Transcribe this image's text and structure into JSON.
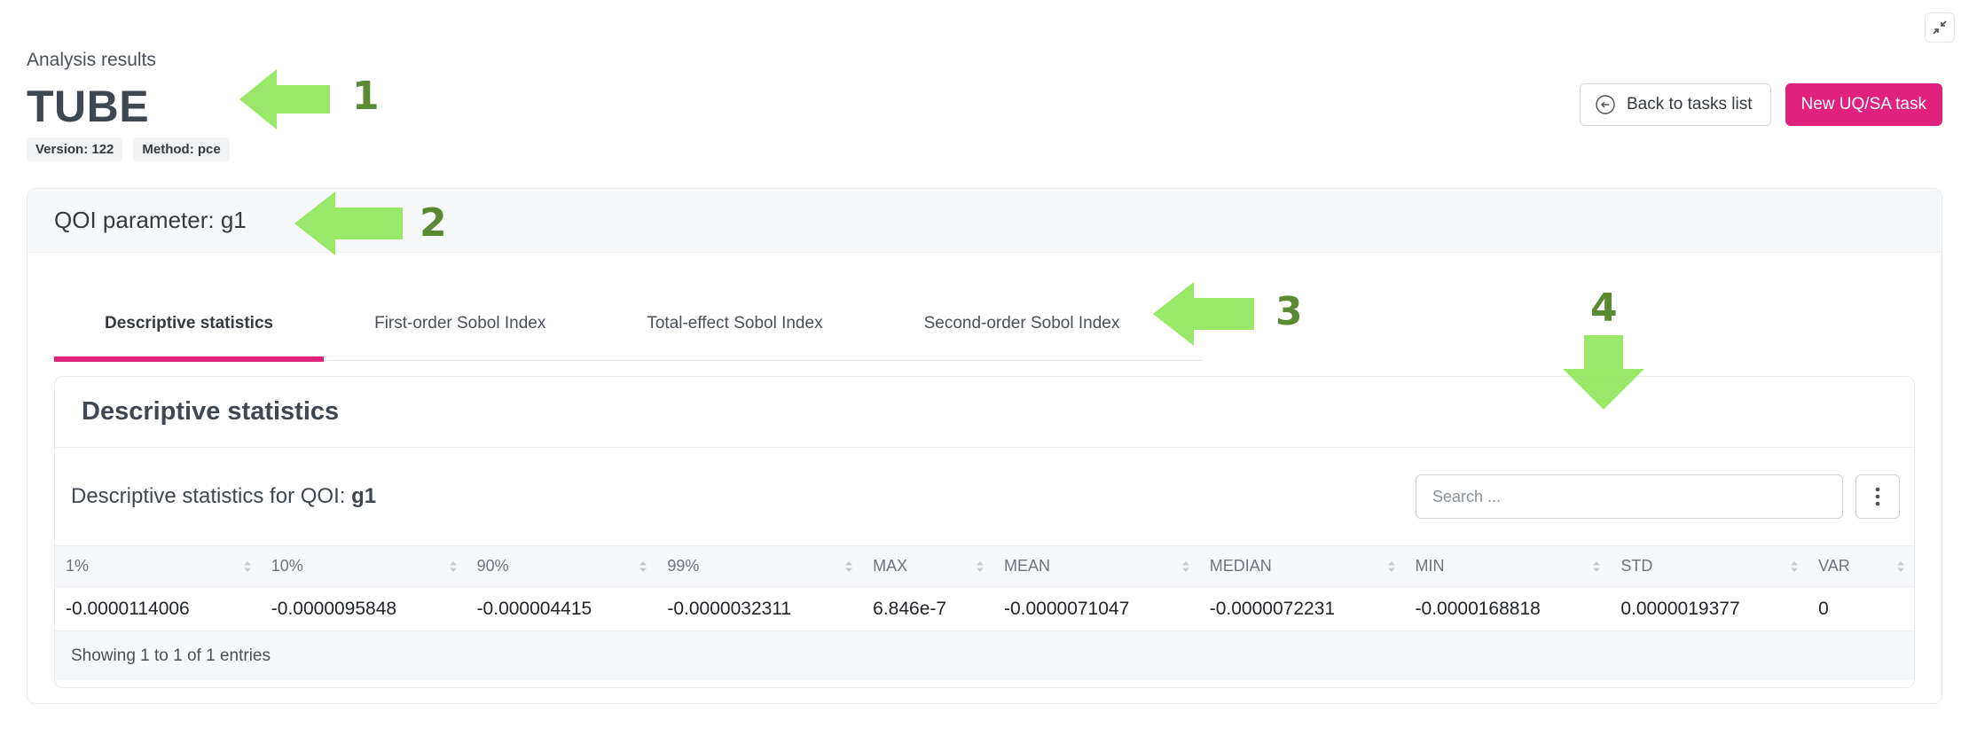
{
  "header": {
    "subtitle": "Analysis results",
    "title": "TUBE",
    "badges": {
      "version": "Version: 122",
      "method": "Method: pce"
    },
    "back_button_label": "Back to tasks list",
    "new_task_button_label": "New UQ/SA task"
  },
  "card": {
    "title": "QOI parameter: g1",
    "tabs": [
      {
        "label": "Descriptive statistics",
        "active": true
      },
      {
        "label": "First-order Sobol Index",
        "active": false
      },
      {
        "label": "Total-effect Sobol Index",
        "active": false
      },
      {
        "label": "Second-order Sobol Index",
        "active": false
      }
    ]
  },
  "stats": {
    "title": "Descriptive statistics",
    "caption_prefix": "Descriptive statistics for QOI: ",
    "caption_qoi": "g1",
    "search_placeholder": "Search ...",
    "columns": [
      "1%",
      "10%",
      "90%",
      "99%",
      "MAX",
      "MEAN",
      "MEDIAN",
      "MIN",
      "STD",
      "VAR"
    ],
    "rows": [
      [
        "-0.0000114006",
        "-0.0000095848",
        "-0.000004415",
        "-0.0000032311",
        "6.846e-7",
        "-0.0000071047",
        "-0.0000072231",
        "-0.0000168818",
        "0.0000019377",
        "0"
      ]
    ],
    "footer": "Showing 1 to 1 of 1 entries"
  },
  "annotations": [
    "1",
    "2",
    "3",
    "4"
  ],
  "colors": {
    "accent": "#e0227e",
    "annotation_arrow": "#8ee65a",
    "annotation_number": "#5a8a32"
  }
}
